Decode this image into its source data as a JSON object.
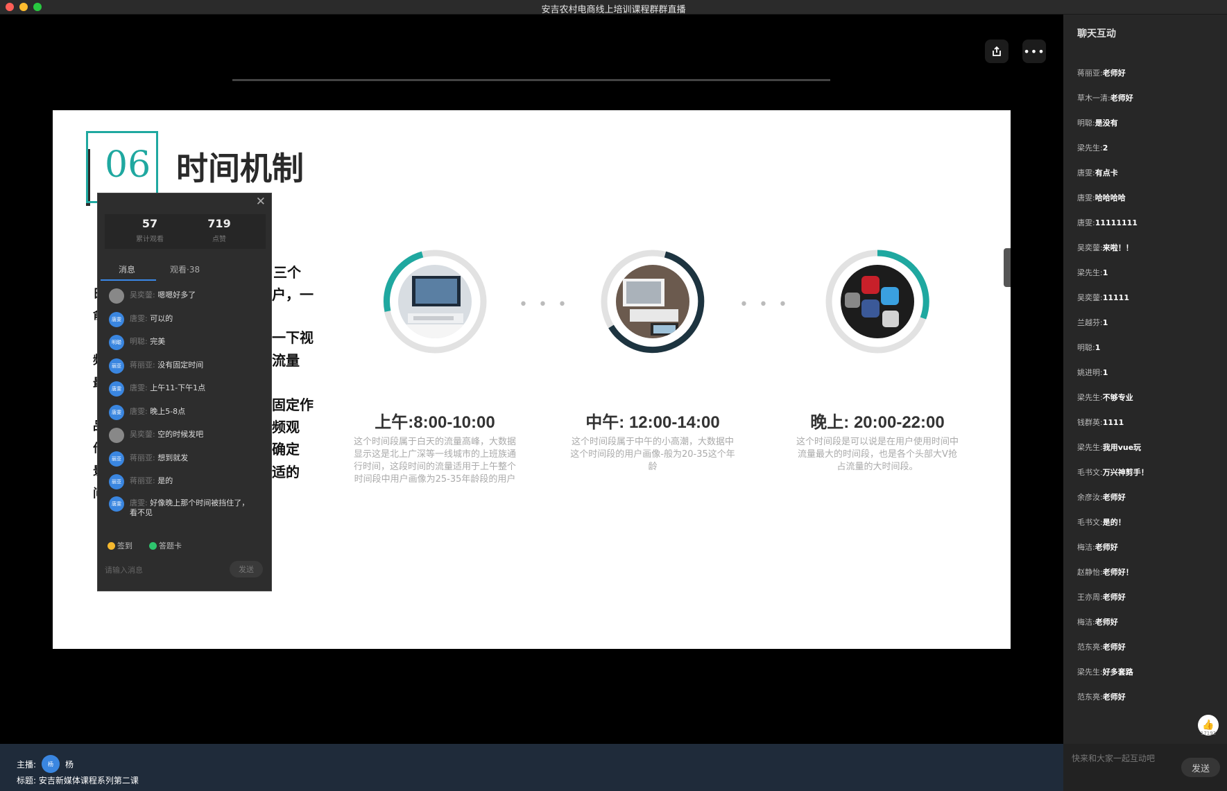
{
  "window": {
    "title": "安吉农村电商线上培训课程群群直播"
  },
  "stage": {
    "share_icon": "share-icon",
    "more_icon": "more-icon"
  },
  "slide": {
    "number": "06",
    "title": "时间机制",
    "fragments": [
      "三个",
      "户，一",
      "一下视",
      "流量",
      "固定作",
      "频观",
      "确定",
      "适的"
    ],
    "left_fragments": [
      "日",
      "俞",
      "频",
      "最",
      "品",
      "作",
      "景",
      "问",
      "日"
    ],
    "segments": [
      {
        "time": "上午:8:00-10:00",
        "desc": "这个时间段属于白天的流量高峰，大数据显示这是北上广深等一线城市的上班族通行时间，这段时间的流量适用于上午整个时间段中用户画像为25-35年龄段的用户"
      },
      {
        "time": "中午: 12:00-14:00",
        "desc": "这个时间段属于中午的小高潮，大数据中这个时间段的用户画像-般为20-35这个年龄"
      },
      {
        "time": "晚上: 20:00-22:00",
        "desc": "这个时间段是可以说是在用户使用时间中流量最大的时间段，也是各个头部大V抢占流量的大时间段。"
      }
    ],
    "ellipsis": "• • •"
  },
  "panel": {
    "close": "✕",
    "viewers": "57",
    "viewers_label": "累计观看",
    "likes": "719",
    "likes_label": "点赞",
    "tab_messages": "消息",
    "tab_watch": "观看·38",
    "messages": [
      {
        "avatar": "",
        "name": "吴奕蓥:",
        "text": "嗯嗯好多了"
      },
      {
        "avatar": "唐雯",
        "name": "唐雯:",
        "text": "可以的"
      },
      {
        "avatar": "明聪",
        "name": "明聪:",
        "text": "完美"
      },
      {
        "avatar": "丽亚",
        "name": "蒋丽亚:",
        "text": "没有固定时间"
      },
      {
        "avatar": "唐雯",
        "name": "唐雯:",
        "text": "上午11-下午1点"
      },
      {
        "avatar": "唐雯",
        "name": "唐雯:",
        "text": "晚上5-8点"
      },
      {
        "avatar": "",
        "name": "吴奕蓥:",
        "text": "空的时候发吧"
      },
      {
        "avatar": "丽亚",
        "name": "蒋丽亚:",
        "text": "想到就发"
      },
      {
        "avatar": "丽亚",
        "name": "蒋丽亚:",
        "text": "是的"
      },
      {
        "avatar": "唐雯",
        "name": "唐雯:",
        "text": "好像晚上那个时间被挡住了，看不见"
      }
    ],
    "checkin": "签到",
    "answer_card": "答题卡",
    "input_placeholder": "请输入消息",
    "send": "发送"
  },
  "chat": {
    "header": "聊天互动",
    "items": [
      {
        "name": "蒋丽亚:",
        "text": "老师好"
      },
      {
        "name": "草木一清:",
        "text": "老师好"
      },
      {
        "name": "明聪:",
        "text": "是没有"
      },
      {
        "name": "梁先生:",
        "text": "2"
      },
      {
        "name": "唐雯:",
        "text": "有点卡"
      },
      {
        "name": "唐雯:",
        "text": "哈哈哈哈"
      },
      {
        "name": "唐雯:",
        "text": "11111111"
      },
      {
        "name": "吴奕蓥:",
        "text": "来啦！！"
      },
      {
        "name": "梁先生:",
        "text": "1"
      },
      {
        "name": "吴奕蓥:",
        "text": "11111"
      },
      {
        "name": "兰越芬:",
        "text": "1"
      },
      {
        "name": "明聪:",
        "text": "1"
      },
      {
        "name": "姚进明:",
        "text": "1"
      },
      {
        "name": "梁先生:",
        "text": "不够专业"
      },
      {
        "name": "钱群英:",
        "text": "1111"
      },
      {
        "name": "梁先生:",
        "text": "我用vue玩"
      },
      {
        "name": "毛书文:",
        "text": "万兴神剪手！"
      },
      {
        "name": "余彦汝:",
        "text": "老师好"
      },
      {
        "name": "毛书文:",
        "text": "是的！"
      },
      {
        "name": "梅洁:",
        "text": "老师好"
      },
      {
        "name": "赵静怡:",
        "text": "老师好！"
      },
      {
        "name": "王亦周:",
        "text": "老师好"
      },
      {
        "name": "梅洁:",
        "text": "老师好"
      },
      {
        "name": "范东亮:",
        "text": "老师好"
      },
      {
        "name": "梁先生:",
        "text": "好多套路"
      },
      {
        "name": "范东亮:",
        "text": "老师好"
      }
    ],
    "like_count": "17193",
    "input_placeholder": "快来和大家一起互动吧",
    "send": "发送"
  },
  "bottom": {
    "host_label": "主播:",
    "host_avatar": "杨",
    "host_name": "杨",
    "title_label": "标题:",
    "title": "安吉新媒体课程系列第二课"
  }
}
